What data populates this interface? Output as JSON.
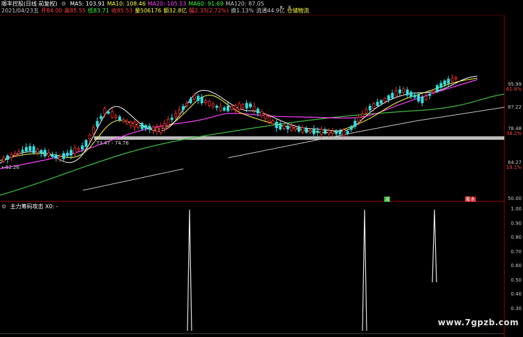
{
  "header": {
    "title": "顺丰控股(日线 前复权)",
    "indicators": [
      {
        "label": "MA5: 103.91",
        "color": "#ffffff"
      },
      {
        "label": "MA10: 108.46",
        "color": "#ffff40"
      },
      {
        "label": "MA20: 105.13",
        "color": "#ff40ff"
      },
      {
        "label": "MA60: 91.69",
        "color": "#40ff40"
      },
      {
        "label": "MA120: 87.05",
        "color": "#c8c8c8"
      }
    ],
    "info": [
      {
        "label": "2021/04/23五",
        "color": "#c8c8c8"
      },
      {
        "label": "开84.00",
        "color": "#ff4040"
      },
      {
        "label": "高85.55",
        "color": "#ff4040"
      },
      {
        "label": "低83.71",
        "color": "#40ff40"
      },
      {
        "label": "收85.53",
        "color": "#ff4040"
      },
      {
        "label": "量506176",
        "color": "#ffff40"
      },
      {
        "label": "额32.8亿",
        "color": "#ffff40"
      },
      {
        "label": "幅2.35(2.72%)",
        "color": "#ff4040"
      },
      {
        "label": "换1.13%",
        "color": "#c8c8c8"
      },
      {
        "label": "流通44.9亿",
        "color": "#c8c8c8"
      },
      {
        "label": "仓储物流",
        "color": "#ffff40"
      }
    ]
  },
  "price_axis": {
    "labels": [
      {
        "text": "95.99",
        "red": false
      },
      {
        "text": "61.8%",
        "red": true
      },
      {
        "text": "87.22",
        "red": false
      },
      {
        "text": "78.48",
        "red": false
      },
      {
        "text": "38.2%",
        "red": true
      },
      {
        "text": "64.27",
        "red": false
      },
      {
        "text": "19.1%",
        "red": true
      },
      {
        "text": "50.00",
        "red": false
      }
    ]
  },
  "annotations": {
    "support_label": "73.47 - 74.78",
    "low_label": "←62.26",
    "badge_jian": "减",
    "badge_xianxia": "筹水"
  },
  "sub_chart": {
    "title": "主力筹码攻击 X0: -",
    "axis": [
      "1.00",
      "0.90",
      "0.80",
      "0.70",
      "0.60",
      "0.50",
      "0.40",
      "0.30"
    ]
  },
  "watermark": "www.7gpzb.com",
  "colors": {
    "up": "#ff3030",
    "down": "#30e0e0",
    "ma5": "#ffffff",
    "ma10": "#ffff40",
    "ma20": "#ff40ff",
    "ma60": "#40c040",
    "ma120": "#c8c8c8",
    "support": "#bbbbbb",
    "spike": "#e8e8e8"
  }
}
